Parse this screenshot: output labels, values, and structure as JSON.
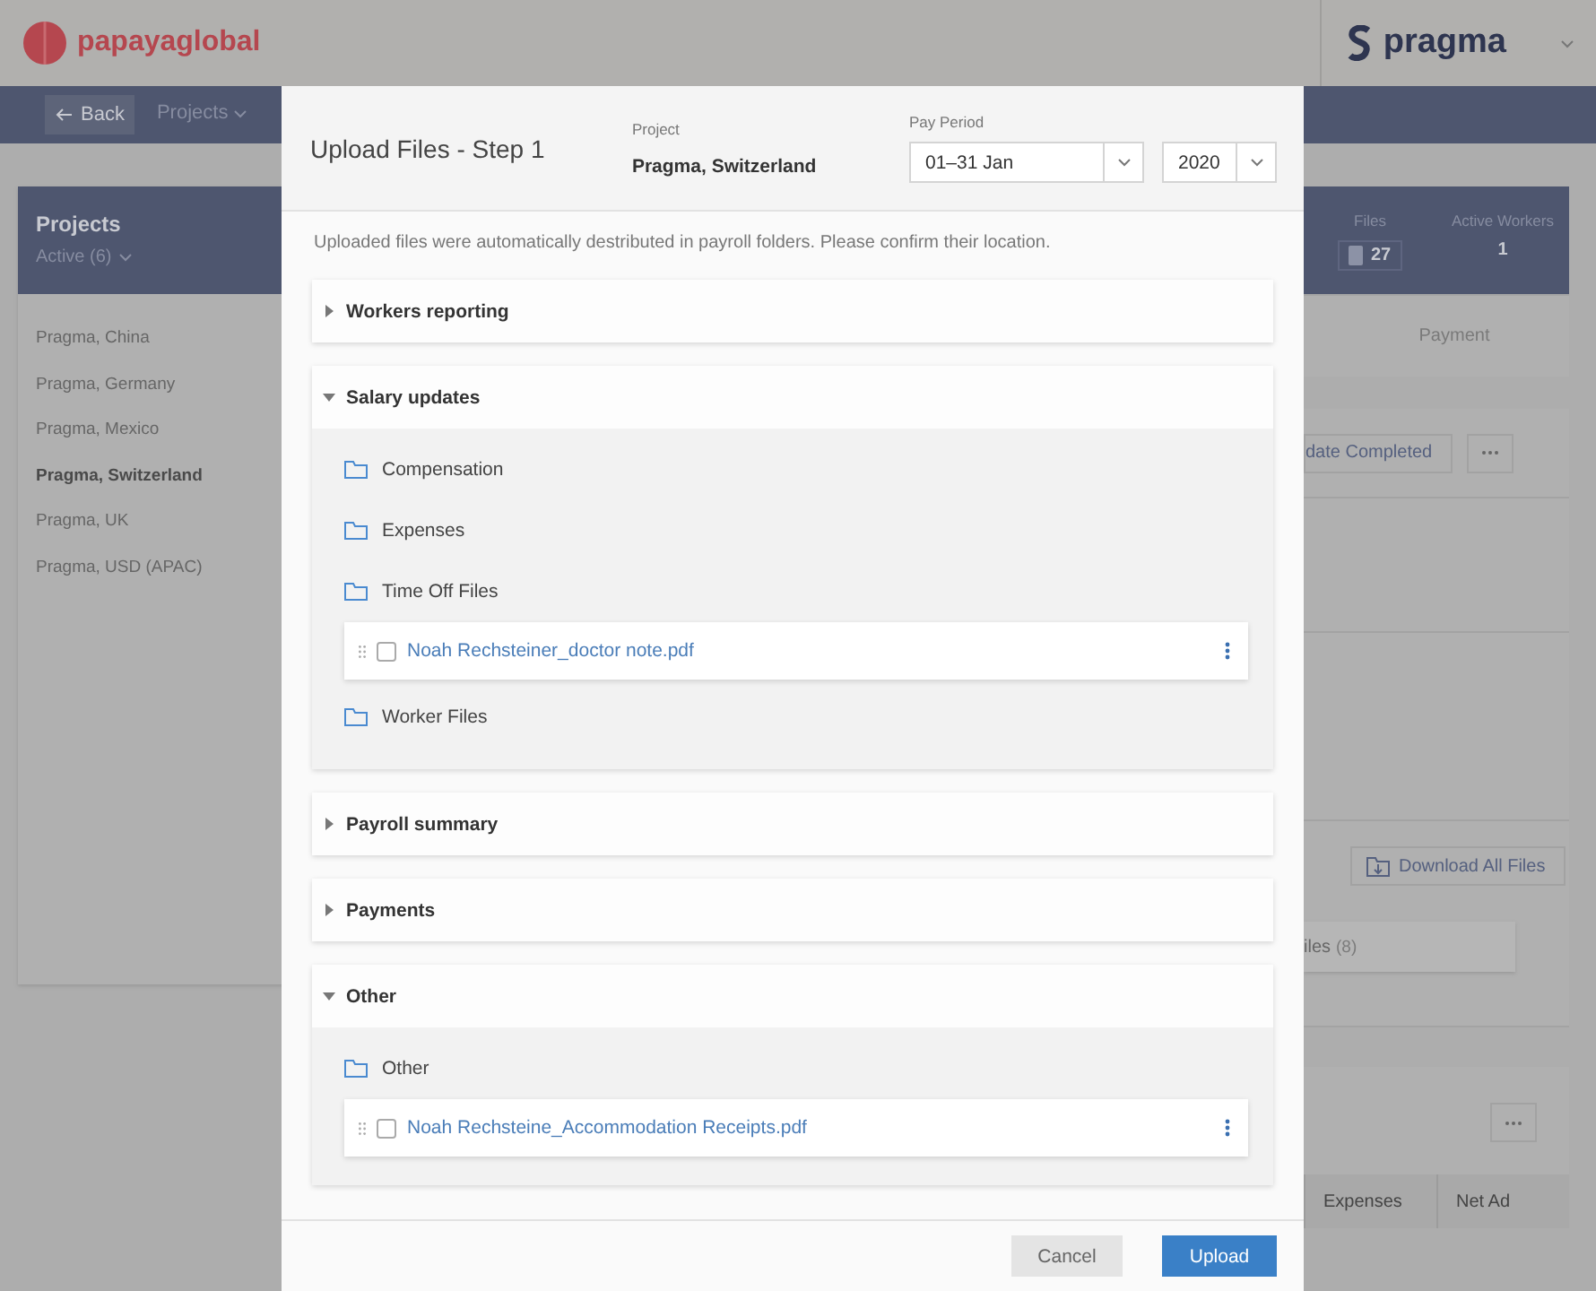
{
  "header": {
    "logo": "papayaglobal",
    "client": "pragma"
  },
  "nav": {
    "back": "Back",
    "items": [
      {
        "label": "Projects",
        "kind": "menu",
        "selected": false
      }
    ]
  },
  "projects_panel": {
    "title": "Projects",
    "filter": "Active (6)",
    "items": [
      {
        "label": "Pragma, China",
        "selected": false
      },
      {
        "label": "Pragma, Germany",
        "selected": false
      },
      {
        "label": "Pragma, Mexico",
        "selected": false
      },
      {
        "label": "Pragma, Switzerland",
        "selected": true
      },
      {
        "label": "Pragma, UK",
        "selected": false
      },
      {
        "label": "Pragma, USD (APAC)",
        "selected": false
      }
    ]
  },
  "summary": {
    "stats": [
      {
        "label": "Files",
        "value": "27",
        "kind": "files"
      },
      {
        "label": "Active Workers",
        "value": "1",
        "kind": "plain"
      }
    ],
    "tab": "Payment",
    "status_button": "date Completed",
    "download_button": "Download All Files",
    "files_tab": {
      "label": "iles",
      "count": "(8)"
    },
    "table_columns": [
      "Expenses",
      "Net Ad"
    ]
  },
  "modal": {
    "title": "Upload Files - Step 1",
    "project_label": "Project",
    "project": "Pragma, Switzerland",
    "period_label": "Pay Period",
    "period": "01–31 Jan",
    "year": "2020",
    "intro": "Uploaded files were automatically destributed in payroll folders. Please confirm their location.",
    "sections": [
      {
        "label": "Workers reporting",
        "expanded": false
      },
      {
        "label": "Salary updates",
        "expanded": true,
        "folders": [
          {
            "label": "Compensation"
          },
          {
            "label": "Expenses"
          },
          {
            "label": "Time Off Files",
            "files": [
              {
                "name": "Noah Rechsteiner_doctor note.pdf",
                "checked": false
              }
            ]
          },
          {
            "label": "Worker Files"
          }
        ]
      },
      {
        "label": "Payroll summary",
        "expanded": false
      },
      {
        "label": "Payments",
        "expanded": false
      },
      {
        "label": "Other",
        "expanded": true,
        "folders": [
          {
            "label": "Other",
            "files": [
              {
                "name": "Noah Rechsteine_Accommodation Receipts.pdf",
                "checked": false
              }
            ]
          }
        ]
      }
    ],
    "buttons": [
      {
        "label": "Cancel",
        "kind": "secondary"
      },
      {
        "label": "Upload",
        "kind": "primary"
      }
    ]
  }
}
